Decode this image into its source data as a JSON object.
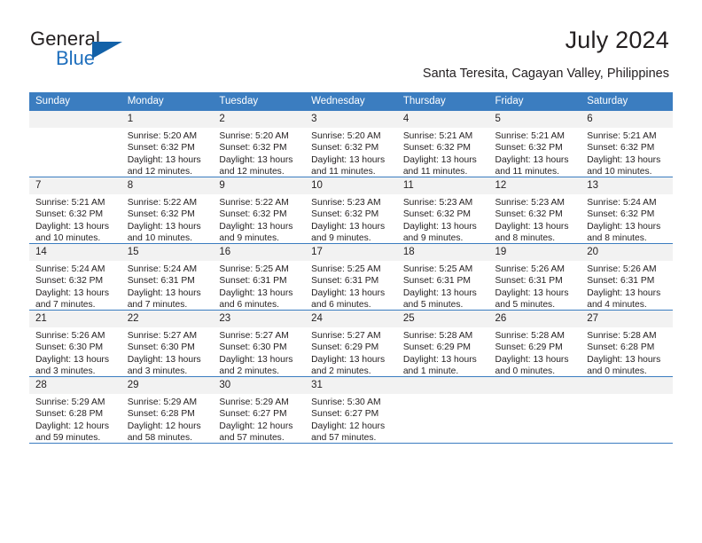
{
  "brand": {
    "name_top": "General",
    "name_bottom": "Blue"
  },
  "header": {
    "title": "July 2024",
    "subtitle": "Santa Teresita, Cagayan Valley, Philippines"
  },
  "theme": {
    "header_blue": "#3b7dc0",
    "daynum_gray": "#f2f2f2",
    "text": "#231f20",
    "logo_blue": "#1f6fbd"
  },
  "columns": [
    "Sunday",
    "Monday",
    "Tuesday",
    "Wednesday",
    "Thursday",
    "Friday",
    "Saturday"
  ],
  "weeks": [
    [
      {
        "day": "",
        "sunrise": "",
        "sunset": "",
        "daylight1": "",
        "daylight2": ""
      },
      {
        "day": "1",
        "sunrise": "Sunrise: 5:20 AM",
        "sunset": "Sunset: 6:32 PM",
        "daylight1": "Daylight: 13 hours",
        "daylight2": "and 12 minutes."
      },
      {
        "day": "2",
        "sunrise": "Sunrise: 5:20 AM",
        "sunset": "Sunset: 6:32 PM",
        "daylight1": "Daylight: 13 hours",
        "daylight2": "and 12 minutes."
      },
      {
        "day": "3",
        "sunrise": "Sunrise: 5:20 AM",
        "sunset": "Sunset: 6:32 PM",
        "daylight1": "Daylight: 13 hours",
        "daylight2": "and 11 minutes."
      },
      {
        "day": "4",
        "sunrise": "Sunrise: 5:21 AM",
        "sunset": "Sunset: 6:32 PM",
        "daylight1": "Daylight: 13 hours",
        "daylight2": "and 11 minutes."
      },
      {
        "day": "5",
        "sunrise": "Sunrise: 5:21 AM",
        "sunset": "Sunset: 6:32 PM",
        "daylight1": "Daylight: 13 hours",
        "daylight2": "and 11 minutes."
      },
      {
        "day": "6",
        "sunrise": "Sunrise: 5:21 AM",
        "sunset": "Sunset: 6:32 PM",
        "daylight1": "Daylight: 13 hours",
        "daylight2": "and 10 minutes."
      }
    ],
    [
      {
        "day": "7",
        "sunrise": "Sunrise: 5:21 AM",
        "sunset": "Sunset: 6:32 PM",
        "daylight1": "Daylight: 13 hours",
        "daylight2": "and 10 minutes."
      },
      {
        "day": "8",
        "sunrise": "Sunrise: 5:22 AM",
        "sunset": "Sunset: 6:32 PM",
        "daylight1": "Daylight: 13 hours",
        "daylight2": "and 10 minutes."
      },
      {
        "day": "9",
        "sunrise": "Sunrise: 5:22 AM",
        "sunset": "Sunset: 6:32 PM",
        "daylight1": "Daylight: 13 hours",
        "daylight2": "and 9 minutes."
      },
      {
        "day": "10",
        "sunrise": "Sunrise: 5:23 AM",
        "sunset": "Sunset: 6:32 PM",
        "daylight1": "Daylight: 13 hours",
        "daylight2": "and 9 minutes."
      },
      {
        "day": "11",
        "sunrise": "Sunrise: 5:23 AM",
        "sunset": "Sunset: 6:32 PM",
        "daylight1": "Daylight: 13 hours",
        "daylight2": "and 9 minutes."
      },
      {
        "day": "12",
        "sunrise": "Sunrise: 5:23 AM",
        "sunset": "Sunset: 6:32 PM",
        "daylight1": "Daylight: 13 hours",
        "daylight2": "and 8 minutes."
      },
      {
        "day": "13",
        "sunrise": "Sunrise: 5:24 AM",
        "sunset": "Sunset: 6:32 PM",
        "daylight1": "Daylight: 13 hours",
        "daylight2": "and 8 minutes."
      }
    ],
    [
      {
        "day": "14",
        "sunrise": "Sunrise: 5:24 AM",
        "sunset": "Sunset: 6:32 PM",
        "daylight1": "Daylight: 13 hours",
        "daylight2": "and 7 minutes."
      },
      {
        "day": "15",
        "sunrise": "Sunrise: 5:24 AM",
        "sunset": "Sunset: 6:31 PM",
        "daylight1": "Daylight: 13 hours",
        "daylight2": "and 7 minutes."
      },
      {
        "day": "16",
        "sunrise": "Sunrise: 5:25 AM",
        "sunset": "Sunset: 6:31 PM",
        "daylight1": "Daylight: 13 hours",
        "daylight2": "and 6 minutes."
      },
      {
        "day": "17",
        "sunrise": "Sunrise: 5:25 AM",
        "sunset": "Sunset: 6:31 PM",
        "daylight1": "Daylight: 13 hours",
        "daylight2": "and 6 minutes."
      },
      {
        "day": "18",
        "sunrise": "Sunrise: 5:25 AM",
        "sunset": "Sunset: 6:31 PM",
        "daylight1": "Daylight: 13 hours",
        "daylight2": "and 5 minutes."
      },
      {
        "day": "19",
        "sunrise": "Sunrise: 5:26 AM",
        "sunset": "Sunset: 6:31 PM",
        "daylight1": "Daylight: 13 hours",
        "daylight2": "and 5 minutes."
      },
      {
        "day": "20",
        "sunrise": "Sunrise: 5:26 AM",
        "sunset": "Sunset: 6:31 PM",
        "daylight1": "Daylight: 13 hours",
        "daylight2": "and 4 minutes."
      }
    ],
    [
      {
        "day": "21",
        "sunrise": "Sunrise: 5:26 AM",
        "sunset": "Sunset: 6:30 PM",
        "daylight1": "Daylight: 13 hours",
        "daylight2": "and 3 minutes."
      },
      {
        "day": "22",
        "sunrise": "Sunrise: 5:27 AM",
        "sunset": "Sunset: 6:30 PM",
        "daylight1": "Daylight: 13 hours",
        "daylight2": "and 3 minutes."
      },
      {
        "day": "23",
        "sunrise": "Sunrise: 5:27 AM",
        "sunset": "Sunset: 6:30 PM",
        "daylight1": "Daylight: 13 hours",
        "daylight2": "and 2 minutes."
      },
      {
        "day": "24",
        "sunrise": "Sunrise: 5:27 AM",
        "sunset": "Sunset: 6:29 PM",
        "daylight1": "Daylight: 13 hours",
        "daylight2": "and 2 minutes."
      },
      {
        "day": "25",
        "sunrise": "Sunrise: 5:28 AM",
        "sunset": "Sunset: 6:29 PM",
        "daylight1": "Daylight: 13 hours",
        "daylight2": "and 1 minute."
      },
      {
        "day": "26",
        "sunrise": "Sunrise: 5:28 AM",
        "sunset": "Sunset: 6:29 PM",
        "daylight1": "Daylight: 13 hours",
        "daylight2": "and 0 minutes."
      },
      {
        "day": "27",
        "sunrise": "Sunrise: 5:28 AM",
        "sunset": "Sunset: 6:28 PM",
        "daylight1": "Daylight: 13 hours",
        "daylight2": "and 0 minutes."
      }
    ],
    [
      {
        "day": "28",
        "sunrise": "Sunrise: 5:29 AM",
        "sunset": "Sunset: 6:28 PM",
        "daylight1": "Daylight: 12 hours",
        "daylight2": "and 59 minutes."
      },
      {
        "day": "29",
        "sunrise": "Sunrise: 5:29 AM",
        "sunset": "Sunset: 6:28 PM",
        "daylight1": "Daylight: 12 hours",
        "daylight2": "and 58 minutes."
      },
      {
        "day": "30",
        "sunrise": "Sunrise: 5:29 AM",
        "sunset": "Sunset: 6:27 PM",
        "daylight1": "Daylight: 12 hours",
        "daylight2": "and 57 minutes."
      },
      {
        "day": "31",
        "sunrise": "Sunrise: 5:30 AM",
        "sunset": "Sunset: 6:27 PM",
        "daylight1": "Daylight: 12 hours",
        "daylight2": "and 57 minutes."
      },
      {
        "day": "",
        "sunrise": "",
        "sunset": "",
        "daylight1": "",
        "daylight2": ""
      },
      {
        "day": "",
        "sunrise": "",
        "sunset": "",
        "daylight1": "",
        "daylight2": ""
      },
      {
        "day": "",
        "sunrise": "",
        "sunset": "",
        "daylight1": "",
        "daylight2": ""
      }
    ]
  ]
}
